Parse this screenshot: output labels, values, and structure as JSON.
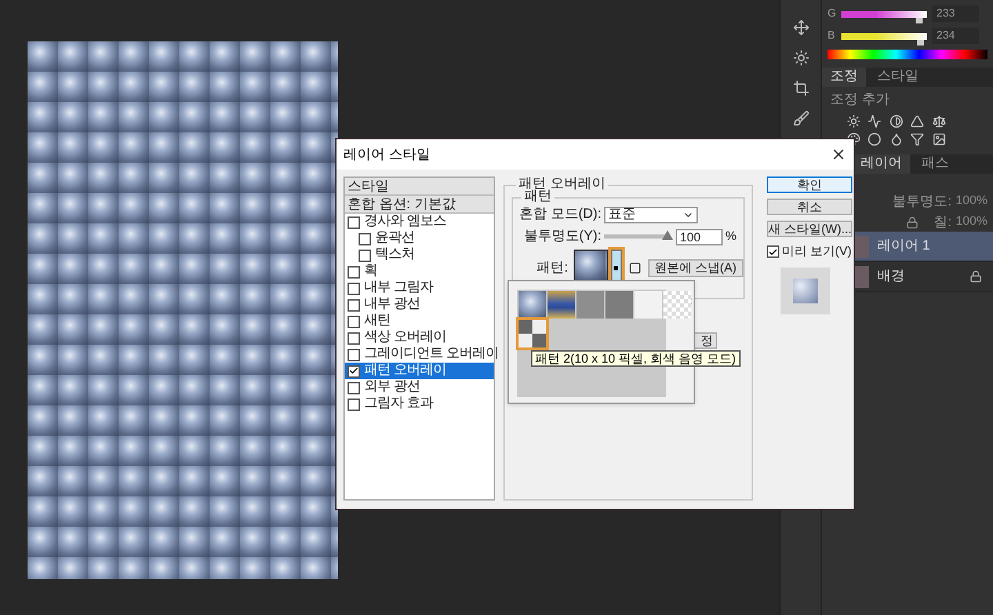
{
  "color_panel": {
    "channels": [
      {
        "label": "G",
        "value": "233",
        "level": 0.91,
        "color": "#d23fd2"
      },
      {
        "label": "B",
        "value": "234",
        "level": 0.92,
        "color": "#e8e230"
      }
    ]
  },
  "adjustments_panel": {
    "tabs": [
      {
        "label": "조정",
        "selected": true
      },
      {
        "label": "스타일",
        "selected": false
      }
    ],
    "subtitle": "조정 추가"
  },
  "layers_panel": {
    "tabs": [
      {
        "label": "레이어",
        "selected": true
      },
      {
        "label": "패스",
        "selected": false
      }
    ],
    "opacity_label": "불투명도:",
    "opacity": "100%",
    "fill_label": "칠:",
    "fill": "100%",
    "layers": [
      {
        "name": "레이어 1",
        "selected": true,
        "locked": false
      },
      {
        "name": "배경",
        "selected": false,
        "locked": true
      }
    ]
  },
  "dialog": {
    "title": "레이어 스타일",
    "styles_list": [
      {
        "label": "스타일",
        "kind": "header",
        "selected": false
      },
      {
        "label": "혼합 옵션: 기본값",
        "kind": "header",
        "selected": false
      },
      {
        "label": "경사와 엠보스",
        "kind": "effect",
        "checked": false,
        "selected": false,
        "children": [
          {
            "label": "윤곽선",
            "checked": false,
            "selected": false
          },
          {
            "label": "텍스처",
            "checked": false,
            "selected": false
          }
        ]
      },
      {
        "label": "획",
        "kind": "effect",
        "checked": false,
        "selected": false
      },
      {
        "label": "내부 그림자",
        "kind": "effect",
        "checked": false,
        "selected": false
      },
      {
        "label": "내부 광선",
        "kind": "effect",
        "checked": false,
        "selected": false
      },
      {
        "label": "새틴",
        "kind": "effect",
        "checked": false,
        "selected": false
      },
      {
        "label": "색상 오버레이",
        "kind": "effect",
        "checked": false,
        "selected": false
      },
      {
        "label": "그레이디언트 오버레이",
        "kind": "effect",
        "checked": false,
        "selected": false
      },
      {
        "label": "패턴 오버레이",
        "kind": "effect",
        "checked": true,
        "selected": true
      },
      {
        "label": "외부 광선",
        "kind": "effect",
        "checked": false,
        "selected": false
      },
      {
        "label": "그림자 효과",
        "kind": "effect",
        "checked": false,
        "selected": false
      }
    ],
    "section_title": "패턴 오버레이",
    "group_title": "패턴",
    "blend_mode_label": "혼합 모드(D):",
    "blend_mode": "표준",
    "opacity": {
      "label": "불투명도(Y):",
      "level": 1,
      "value": "100",
      "unit": "%"
    },
    "pattern_label": "패턴:",
    "pattern_dropdown_highlighted": true,
    "snap_button": "원본에 스냅(A)",
    "hidden_button_fragment": "정",
    "pattern_picker": {
      "swatches": [
        {
          "kind": "bubbles",
          "selected": false
        },
        {
          "kind": "stripes",
          "selected": false
        },
        {
          "kind": "gray",
          "selected": false
        },
        {
          "kind": "dark-gray",
          "selected": false
        },
        {
          "kind": "white",
          "selected": false
        },
        {
          "kind": "checker",
          "selected": false
        },
        {
          "kind": "gray-checker",
          "selected": true
        }
      ],
      "tooltip": "패턴 2(10 x 10 픽셀, 회색 음영 모드)"
    },
    "buttons": [
      {
        "label": "확인",
        "default": true
      },
      {
        "label": "취소",
        "default": false
      },
      {
        "label": "새 스타일(W)...",
        "default": false
      }
    ],
    "preview": {
      "label": "미리 보기(V)",
      "checked": true
    }
  }
}
